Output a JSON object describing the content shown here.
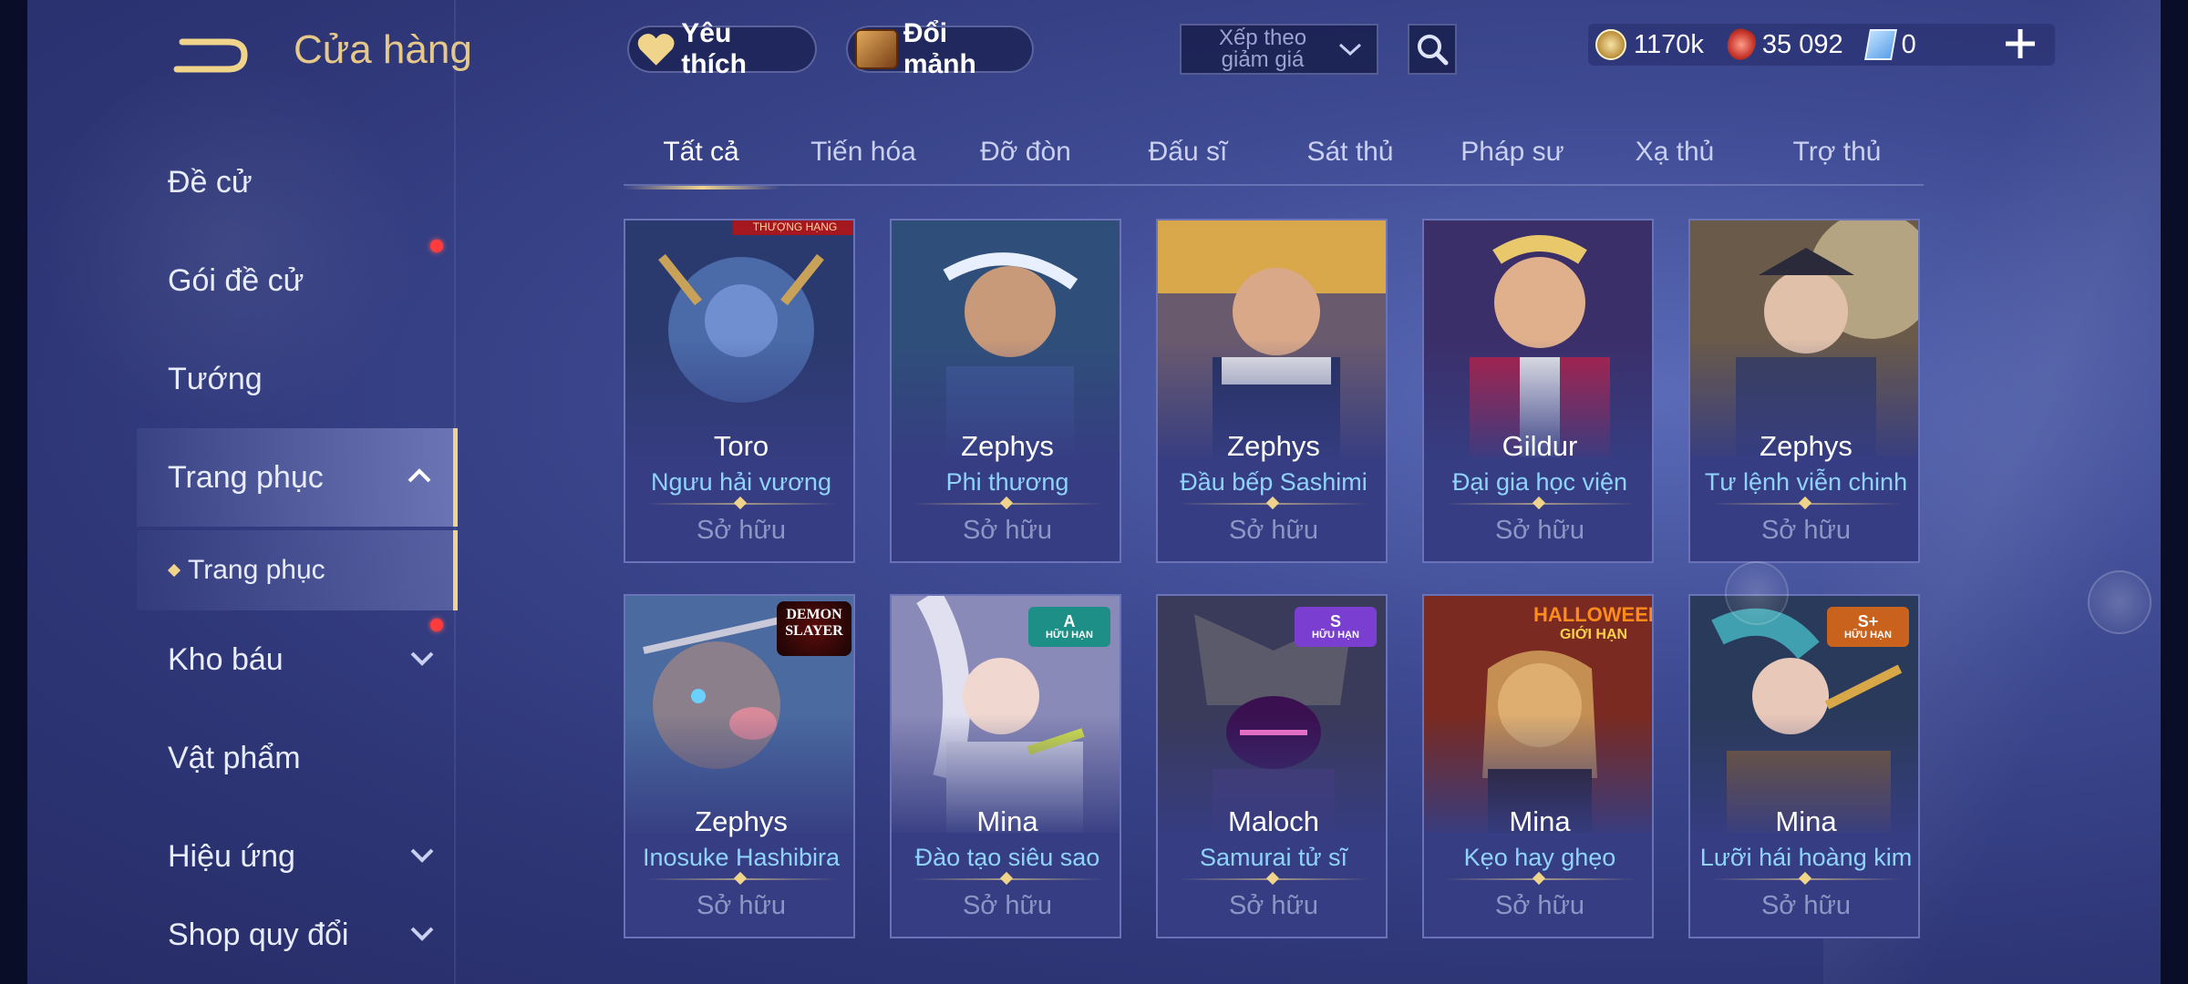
{
  "header": {
    "title": "Cửa hàng",
    "favorites_label": "Yêu thích",
    "shard_exchange_label": "Đổi mảnh",
    "sort_label": "Xếp theo giảm giá",
    "currency": {
      "gold": "1170k",
      "ruby": "35 092",
      "voucher": "0"
    }
  },
  "sidebar": {
    "items": [
      {
        "label": "Đề cử"
      },
      {
        "label": "Gói đề cử"
      },
      {
        "label": "Tướng"
      },
      {
        "label": "Trang phục"
      },
      {
        "label": "Kho báu"
      },
      {
        "label": "Vật phẩm"
      },
      {
        "label": "Hiệu ứng"
      },
      {
        "label": "Shop quy đổi"
      }
    ],
    "sub_item": "Trang phục"
  },
  "tabs": [
    {
      "label": "Tất cả"
    },
    {
      "label": "Tiến hóa"
    },
    {
      "label": "Đỡ đòn"
    },
    {
      "label": "Đấu sĩ"
    },
    {
      "label": "Sát thủ"
    },
    {
      "label": "Pháp sư"
    },
    {
      "label": "Xạ thủ"
    },
    {
      "label": "Trợ thủ"
    }
  ],
  "cards": [
    {
      "hero": "Toro",
      "skin": "Ngưu hải vương",
      "status": "Sở hữu",
      "badge": "THƯỢNG HẠNG"
    },
    {
      "hero": "Zephys",
      "skin": "Phi thương",
      "status": "Sở hữu"
    },
    {
      "hero": "Zephys",
      "skin": "Đầu bếp Sashimi",
      "status": "Sở hữu"
    },
    {
      "hero": "Gildur",
      "skin": "Đại gia học viện",
      "status": "Sở hữu"
    },
    {
      "hero": "Zephys",
      "skin": "Tư lệnh viễn chinh",
      "status": "Sở hữu"
    },
    {
      "hero": "Zephys",
      "skin": "Inosuke Hashibira",
      "status": "Sở hữu",
      "badge_logo": "DEMON SLAYER"
    },
    {
      "hero": "Mina",
      "skin": "Đào tạo siêu sao",
      "status": "Sở hữu",
      "badge_tier": "A",
      "badge_sub": "HỮU HẠN"
    },
    {
      "hero": "Maloch",
      "skin": "Samurai tử sĩ",
      "status": "Sở hữu",
      "badge_tier": "S",
      "badge_sub": "HỮU HẠN"
    },
    {
      "hero": "Mina",
      "skin": "Kẹo hay ghẹo",
      "status": "Sở hữu",
      "badge_hw": "HALLOWEEN",
      "badge_hw_sub": "GIỚI HẠN"
    },
    {
      "hero": "Mina",
      "skin": "Lưỡi hái hoàng kim",
      "status": "Sở hữu",
      "badge_tier": "S+",
      "badge_sub": "HỮU HẠN"
    }
  ],
  "colors": {
    "accent_gold": "#f1d48c",
    "skin_name_blue": "#8fd3ff",
    "owned_gray": "#8e96c6",
    "badge_teal": "#1d8f86",
    "badge_purple": "#7a3fd0",
    "badge_orange": "#c8621c"
  }
}
